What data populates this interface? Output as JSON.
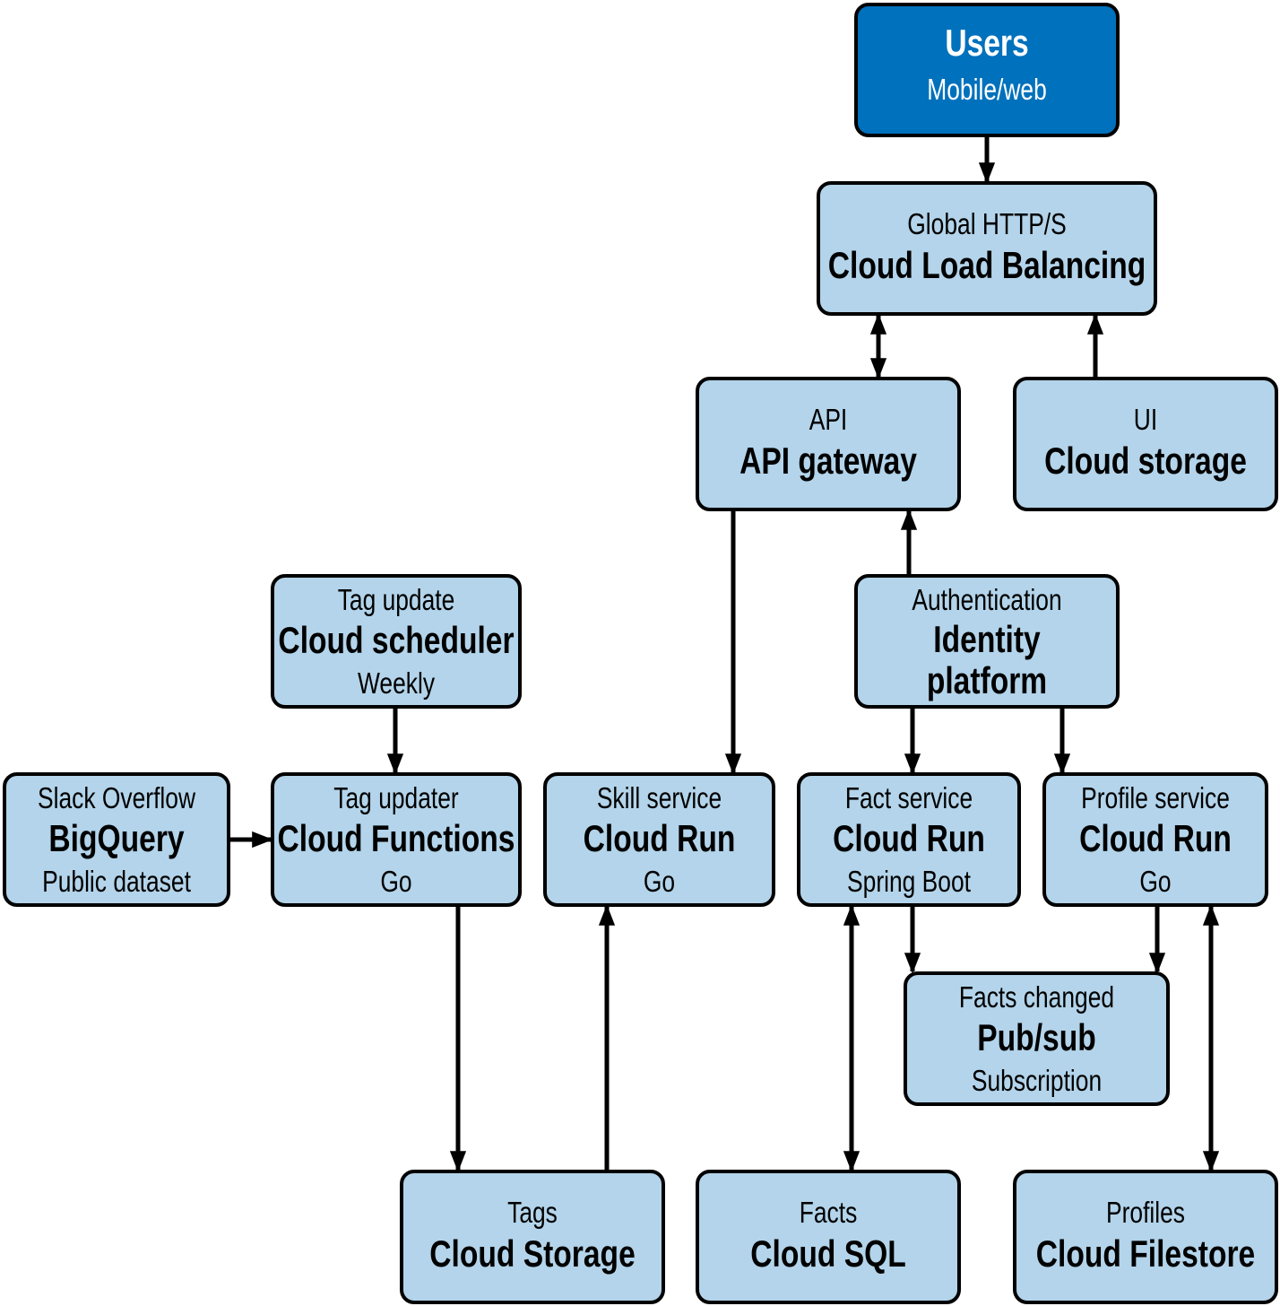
{
  "colors": {
    "box_fill": "#b3d4ea",
    "dark_fill": "#0071bc",
    "stroke": "#000000"
  },
  "nodes": [
    {
      "id": "users",
      "dark": true,
      "lines": [
        {
          "t": "Users",
          "b": true
        },
        {
          "t": "Mobile/web",
          "b": false
        }
      ]
    },
    {
      "id": "load-balancing",
      "lines": [
        {
          "t": "Global HTTP/S",
          "b": false
        },
        {
          "t": "Cloud Load Balancing",
          "b": true
        }
      ]
    },
    {
      "id": "api-gateway",
      "lines": [
        {
          "t": "API",
          "b": false
        },
        {
          "t": "API gateway",
          "b": true
        }
      ]
    },
    {
      "id": "ui-storage",
      "lines": [
        {
          "t": "UI",
          "b": false
        },
        {
          "t": "Cloud storage",
          "b": true
        }
      ]
    },
    {
      "id": "cloud-scheduler",
      "lines": [
        {
          "t": "Tag update",
          "b": false
        },
        {
          "t": "Cloud scheduler",
          "b": true
        },
        {
          "t": "Weekly",
          "b": false
        }
      ]
    },
    {
      "id": "identity-platform",
      "lines": [
        {
          "t": "Authentication",
          "b": false
        },
        {
          "t": "Identity",
          "b": true
        },
        {
          "t": "platform",
          "b": true
        }
      ]
    },
    {
      "id": "bigquery",
      "lines": [
        {
          "t": "Slack Overflow",
          "b": false
        },
        {
          "t": "BigQuery",
          "b": true
        },
        {
          "t": "Public dataset",
          "b": false
        }
      ]
    },
    {
      "id": "cloud-functions",
      "lines": [
        {
          "t": "Tag updater",
          "b": false
        },
        {
          "t": "Cloud Functions",
          "b": true
        },
        {
          "t": "Go",
          "b": false
        }
      ]
    },
    {
      "id": "skill-service",
      "lines": [
        {
          "t": "Skill service",
          "b": false
        },
        {
          "t": "Cloud Run",
          "b": true
        },
        {
          "t": "Go",
          "b": false
        }
      ]
    },
    {
      "id": "fact-service",
      "lines": [
        {
          "t": "Fact service",
          "b": false
        },
        {
          "t": "Cloud Run",
          "b": true
        },
        {
          "t": "Spring Boot",
          "b": false
        }
      ]
    },
    {
      "id": "profile-service",
      "lines": [
        {
          "t": "Profile service",
          "b": false
        },
        {
          "t": "Cloud Run",
          "b": true
        },
        {
          "t": "Go",
          "b": false
        }
      ]
    },
    {
      "id": "pubsub",
      "lines": [
        {
          "t": "Facts changed",
          "b": false
        },
        {
          "t": "Pub/sub",
          "b": true
        },
        {
          "t": "Subscription",
          "b": false
        }
      ]
    },
    {
      "id": "tags-storage",
      "lines": [
        {
          "t": "Tags",
          "b": false
        },
        {
          "t": "Cloud Storage",
          "b": true
        }
      ]
    },
    {
      "id": "facts-sql",
      "lines": [
        {
          "t": "Facts",
          "b": false
        },
        {
          "t": "Cloud SQL",
          "b": true
        }
      ]
    },
    {
      "id": "profiles-filestore",
      "lines": [
        {
          "t": "Profiles",
          "b": false
        },
        {
          "t": "Cloud Filestore",
          "b": true
        }
      ]
    }
  ],
  "edges": [
    {
      "from": "users",
      "to": "load-balancing",
      "bidirectional": false
    },
    {
      "from": "load-balancing",
      "to": "api-gateway",
      "bidirectional": true
    },
    {
      "from": "ui-storage",
      "to": "load-balancing",
      "bidirectional": false
    },
    {
      "from": "api-gateway",
      "to": "skill-service",
      "bidirectional": false
    },
    {
      "from": "identity-platform",
      "to": "api-gateway",
      "bidirectional": false
    },
    {
      "from": "identity-platform",
      "to": "fact-service",
      "bidirectional": false
    },
    {
      "from": "identity-platform",
      "to": "profile-service",
      "bidirectional": false
    },
    {
      "from": "cloud-scheduler",
      "to": "cloud-functions",
      "bidirectional": false
    },
    {
      "from": "bigquery",
      "to": "cloud-functions",
      "bidirectional": false
    },
    {
      "from": "cloud-functions",
      "to": "tags-storage",
      "bidirectional": false
    },
    {
      "from": "tags-storage",
      "to": "skill-service",
      "bidirectional": false
    },
    {
      "from": "fact-service",
      "to": "facts-sql",
      "bidirectional": true
    },
    {
      "from": "fact-service",
      "to": "pubsub",
      "bidirectional": false
    },
    {
      "from": "profile-service",
      "to": "pubsub",
      "bidirectional": false
    },
    {
      "from": "profile-service",
      "to": "profiles-filestore",
      "bidirectional": true
    }
  ]
}
